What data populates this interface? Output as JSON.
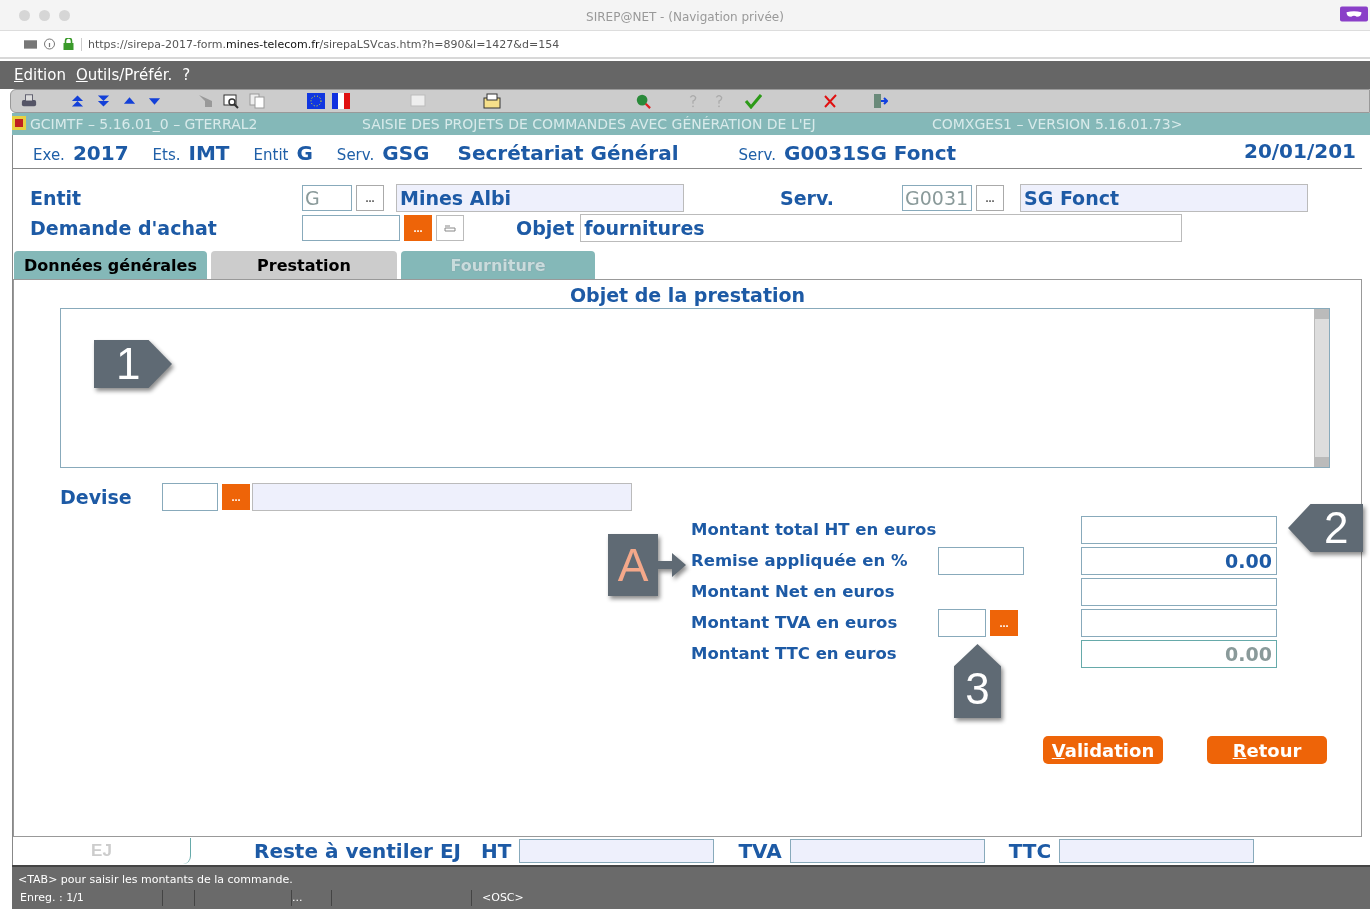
{
  "browser": {
    "title": "SIREP@NET - (Navigation privée)",
    "url": "https://sirepa-2017-form.**mines-telecom.fr**/sirepaLSVcas.htm?h=890&l=1427&d=154"
  },
  "menu": [
    "Edition",
    "Outils/Préfér.",
    "?"
  ],
  "app_header": [
    "GCIMTF – 5.16.01_0 – GTERRAL2",
    "SAISIE DES PROJETS DE COMMANDES AVEC GÉNÉRATION DE L'EJ",
    "COMXGES1 – VERSION 5.16.01.73>"
  ],
  "context": [
    {
      "kind": "label",
      "text": "Exe."
    },
    {
      "kind": "value",
      "text": "2017"
    },
    {
      "kind": "label",
      "text": "Ets."
    },
    {
      "kind": "value",
      "text": "IMT"
    },
    {
      "kind": "label",
      "text": "Entit"
    },
    {
      "kind": "value",
      "text": "G"
    },
    {
      "kind": "label",
      "text": "Serv."
    },
    {
      "kind": "value",
      "text": "GSG"
    },
    {
      "kind": "value",
      "text": "Secrétariat Général"
    },
    {
      "kind": "label",
      "text": "Serv."
    },
    {
      "kind": "value",
      "text": "G0031SG Fonct"
    }
  ],
  "date": "20/01/201",
  "entit": {
    "label": "Entit",
    "code": "G",
    "button": "...",
    "name": "Mines Albi"
  },
  "serv": {
    "label": "Serv.",
    "code": "G0031",
    "button": "...",
    "name": "SG Fonct"
  },
  "demande": {
    "label": "Demande d'achat",
    "button": "..."
  },
  "objet": {
    "label": "Objet",
    "value": "fournitures"
  },
  "tabs": [
    {
      "label": "Données générales",
      "selected": false,
      "disabled": false
    },
    {
      "label": "Prestation",
      "selected": true,
      "disabled": false
    },
    {
      "label": "Fourniture",
      "selected": false,
      "disabled": true
    }
  ],
  "panel_title": "Objet de la prestation",
  "devise": {
    "label": "Devise",
    "button": "..."
  },
  "amounts": [
    {
      "label": "Montant total HT en euros",
      "kind": "plain",
      "disabled": false
    },
    {
      "label": "Remise appliquée en %",
      "kind": "rate",
      "value": "0.00",
      "disabled": false
    },
    {
      "label": "Montant Net en euros",
      "kind": "plain",
      "disabled": false
    },
    {
      "label": "Montant TVA en euros",
      "kind": "lookup",
      "button": "...",
      "disabled": false
    },
    {
      "label": "Montant TTC en euros",
      "kind": "plain",
      "value": "0.00",
      "disabled": true
    }
  ],
  "buttons": [
    "Validation",
    "Retour"
  ],
  "callouts": [
    {
      "label": "1",
      "kind": "right"
    },
    {
      "label": "2",
      "kind": "left"
    },
    {
      "label": "A",
      "kind": "arrow"
    },
    {
      "label": "3",
      "kind": "up"
    }
  ],
  "bottom": {
    "tab": "EJ",
    "title": "Reste à ventiler EJ",
    "fields": [
      "HT",
      "TVA",
      "TTC"
    ]
  },
  "status": {
    "message": "<TAB> pour saisir les montants de la commande.",
    "record": "Enreg. : 1/1",
    "more": "...",
    "mode": "<OSC>"
  }
}
